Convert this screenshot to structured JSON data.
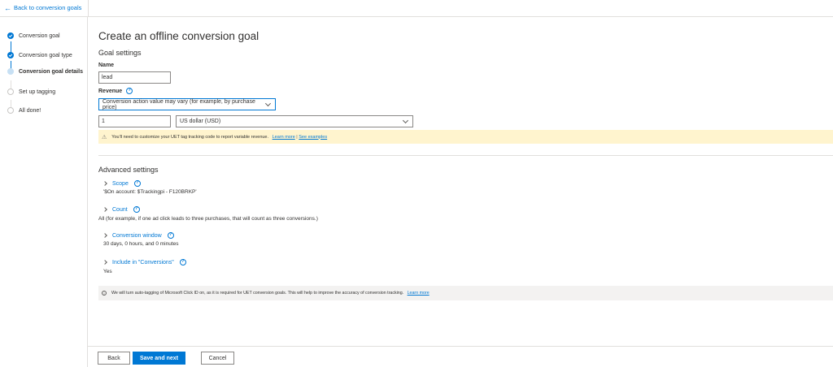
{
  "topbar": {
    "back_label": "Back to conversion goals"
  },
  "sidebar": {
    "steps": [
      {
        "label": "Conversion goal",
        "state": "done"
      },
      {
        "label": "Conversion goal type",
        "state": "done"
      },
      {
        "label": "Conversion goal details",
        "state": "current"
      },
      {
        "label": "Set up tagging",
        "state": "todo"
      },
      {
        "label": "All done!",
        "state": "todo"
      }
    ]
  },
  "page": {
    "title": "Create an offline conversion goal",
    "goal_settings_title": "Goal settings",
    "name_label": "Name",
    "name_value": "lead",
    "revenue_label": "Revenue",
    "revenue_option": "Conversion action value may vary (for example, by purchase price)",
    "revenue_amount": "1",
    "currency": "US dollar (USD)",
    "warning_text": "You'll need to customize your UET tag tracking code to report variable revenue.",
    "warning_link_learn": "Learn more",
    "warning_sep": "|",
    "warning_link_examples": "See examples",
    "advanced_title": "Advanced settings",
    "advanced_items": [
      {
        "label": "Scope",
        "value": "'$On account: $Trackingpi - F120BRKP'"
      },
      {
        "label": "Count",
        "value": "All (for example, if one ad click leads to three purchases, that will count as three conversions.)"
      },
      {
        "label": "Conversion window",
        "value": "30 days, 0 hours, and 0 minutes"
      },
      {
        "label": "Include in \"Conversions\"",
        "value": "Yes"
      }
    ],
    "info_text": "We will turn auto-tagging of Microsoft Click ID on, as it is required for UET conversion goals. This will help to improve the accuracy of conversion tracking.",
    "info_link": "Learn more"
  },
  "footer": {
    "back_label": "Back",
    "save_next_label": "Save and next",
    "cancel_label": "Cancel"
  },
  "colors": {
    "accent": "#0078d4",
    "warning_bg": "#fff4ce",
    "info_bg": "#f3f2f1"
  }
}
